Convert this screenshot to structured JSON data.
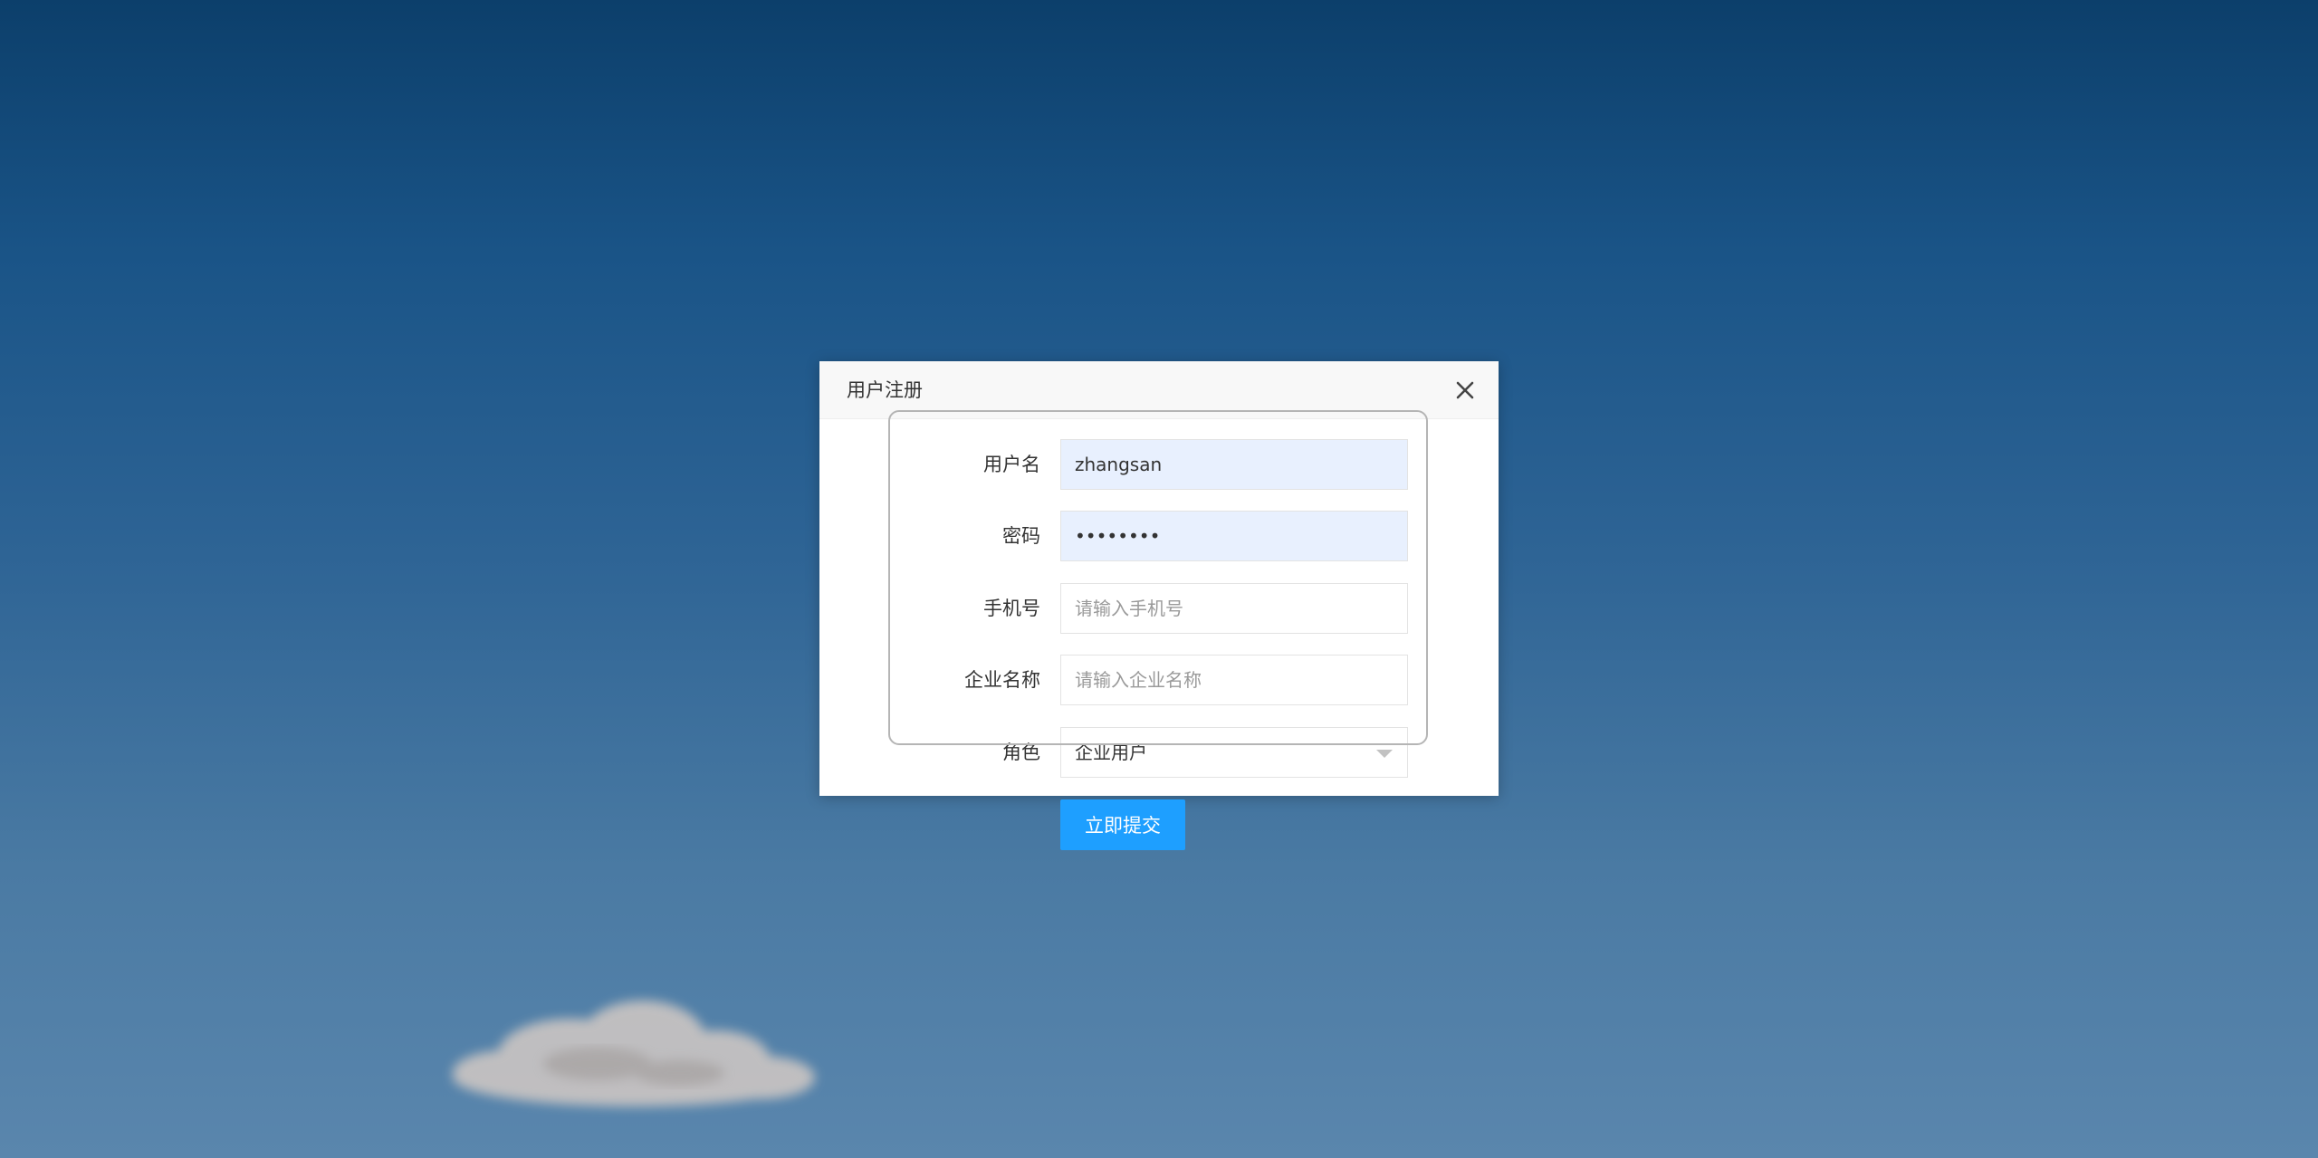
{
  "dialog": {
    "title": "用户注册",
    "close_icon": "close-icon"
  },
  "form": {
    "username": {
      "label": "用户名",
      "value": "zhangsan",
      "placeholder": ""
    },
    "password": {
      "label": "密码",
      "value": "••••••••",
      "placeholder": ""
    },
    "phone": {
      "label": "手机号",
      "value": "",
      "placeholder": "请输入手机号"
    },
    "company": {
      "label": "企业名称",
      "value": "",
      "placeholder": "请输入企业名称"
    },
    "role": {
      "label": "角色",
      "value": "企业用户",
      "icon": "chevron-down-icon"
    },
    "submit_label": "立即提交"
  },
  "colors": {
    "primary": "#1e9fff",
    "autofill": "#e8f0fe"
  }
}
